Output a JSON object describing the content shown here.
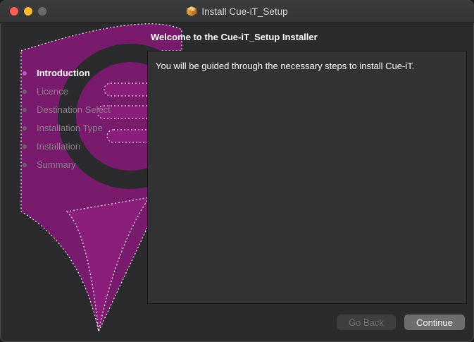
{
  "window": {
    "title": "Install Cue-iT_Setup"
  },
  "heading": "Welcome to the Cue-iT_Setup Installer",
  "sidebar": {
    "steps": [
      {
        "label": "Introduction",
        "active": true
      },
      {
        "label": "Licence",
        "active": false
      },
      {
        "label": "Destination Select",
        "active": false
      },
      {
        "label": "Installation Type",
        "active": false
      },
      {
        "label": "Installation",
        "active": false
      },
      {
        "label": "Summary",
        "active": false
      }
    ]
  },
  "content": {
    "text": "You will be guided through the necessary steps to install Cue-iT."
  },
  "buttons": {
    "back": "Go Back",
    "continue": "Continue"
  },
  "colors": {
    "accent": "#8b1e7a",
    "active_dot": "#b15bc4"
  }
}
